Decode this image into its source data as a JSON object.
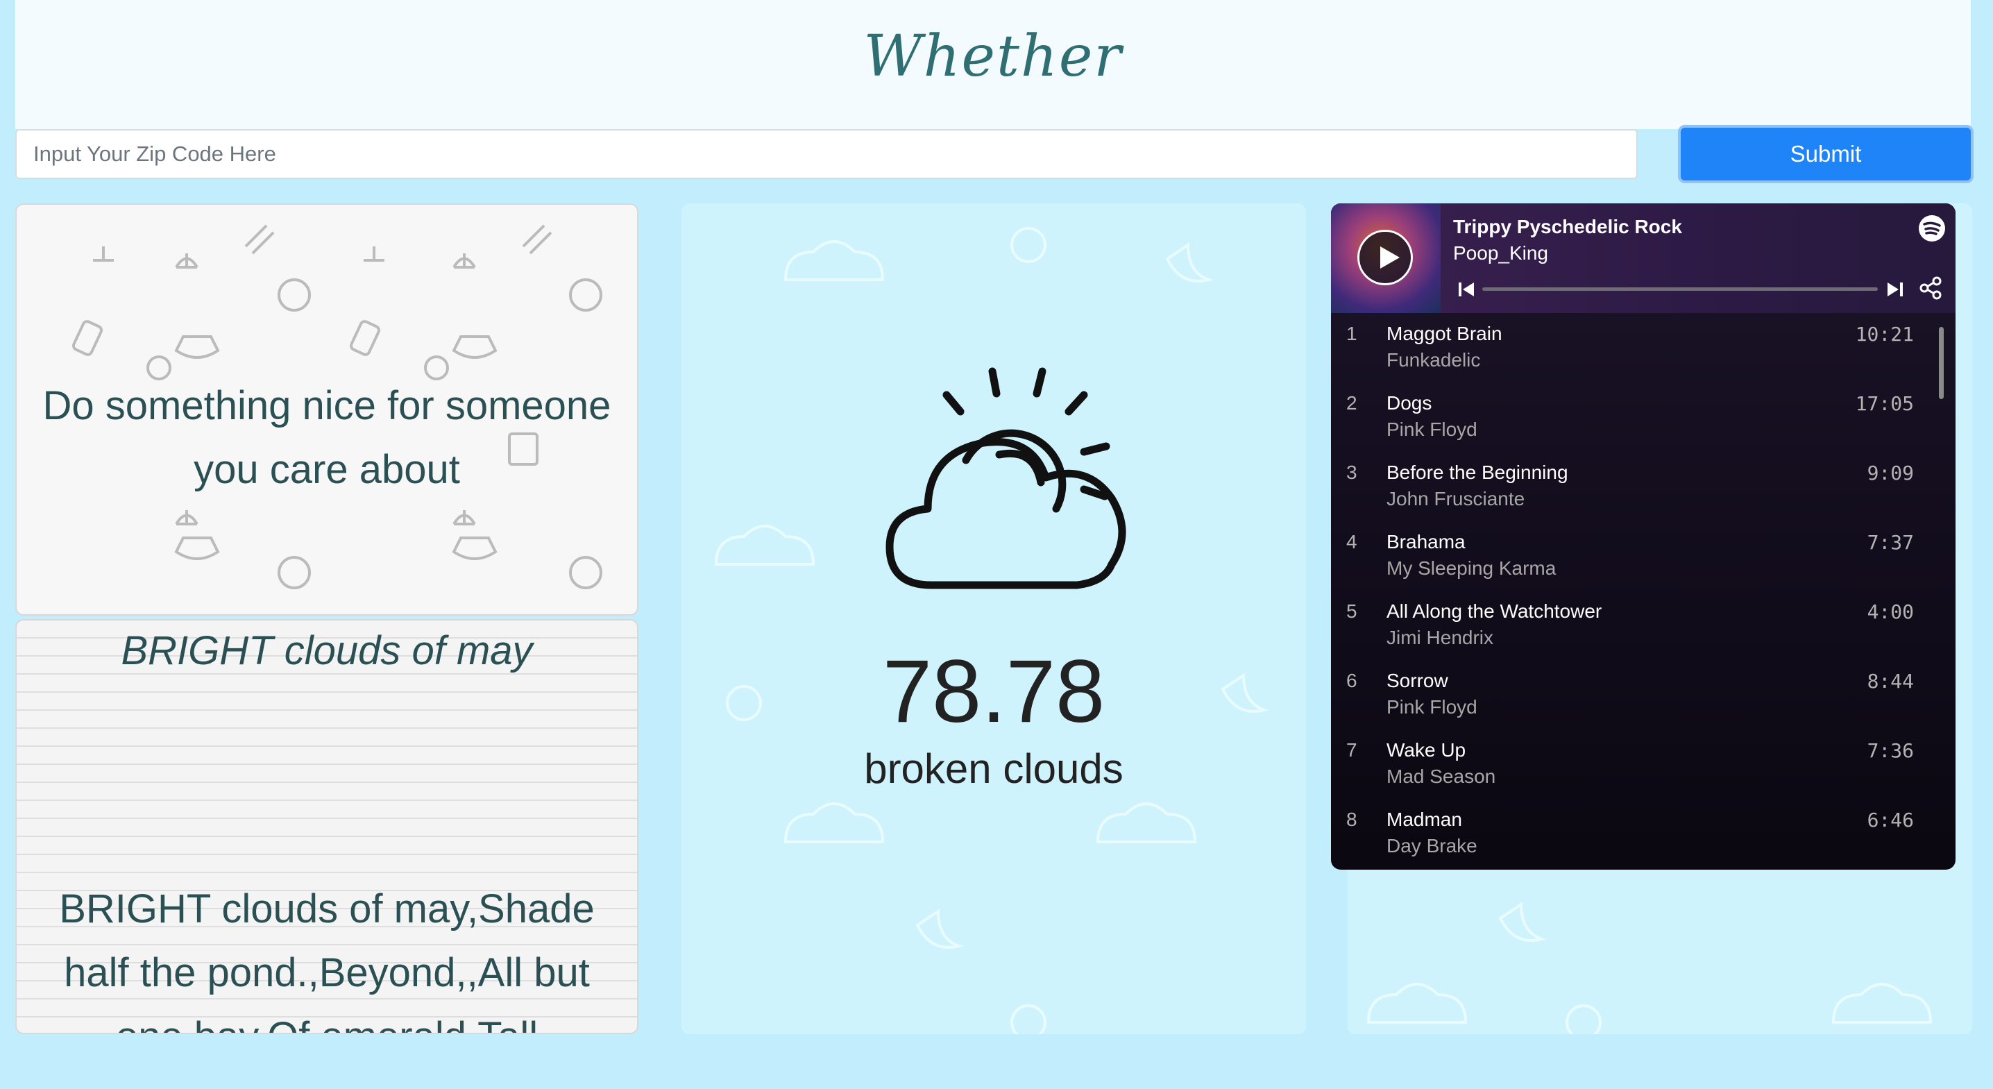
{
  "app": {
    "title": "Whether"
  },
  "search": {
    "placeholder": "Input Your Zip Code Here",
    "value": "",
    "submit_label": "Submit"
  },
  "quote": {
    "text": "Do something nice for someone you care about"
  },
  "poem": {
    "title": "BRIGHT clouds of may",
    "body": "BRIGHT clouds of may,Shade half the pond.,Beyond,,All but one bay,Of emerald,Tall"
  },
  "weather": {
    "temperature": "78.78",
    "description": "broken clouds",
    "icon": "partly-cloudy-icon"
  },
  "spotify": {
    "playlist_title": "Trippy Pyschedelic Rock",
    "owner": "Poop_King",
    "tracks": [
      {
        "num": "1",
        "name": "Maggot Brain",
        "artist": "Funkadelic",
        "duration": "10:21"
      },
      {
        "num": "2",
        "name": "Dogs",
        "artist": "Pink Floyd",
        "duration": "17:05"
      },
      {
        "num": "3",
        "name": "Before the Beginning",
        "artist": "John Frusciante",
        "duration": "9:09"
      },
      {
        "num": "4",
        "name": "Brahama",
        "artist": "My Sleeping Karma",
        "duration": "7:37"
      },
      {
        "num": "5",
        "name": "All Along the Watchtower",
        "artist": "Jimi Hendrix",
        "duration": "4:00"
      },
      {
        "num": "6",
        "name": "Sorrow",
        "artist": "Pink Floyd",
        "duration": "8:44"
      },
      {
        "num": "7",
        "name": "Wake Up",
        "artist": "Mad Season",
        "duration": "7:36"
      },
      {
        "num": "8",
        "name": "Madman",
        "artist": "Day Brake",
        "duration": "6:46"
      }
    ]
  },
  "colors": {
    "background": "#c2edfd",
    "accent": "#1e84f7",
    "title": "#2f6f73",
    "card": "#cff3fd"
  }
}
